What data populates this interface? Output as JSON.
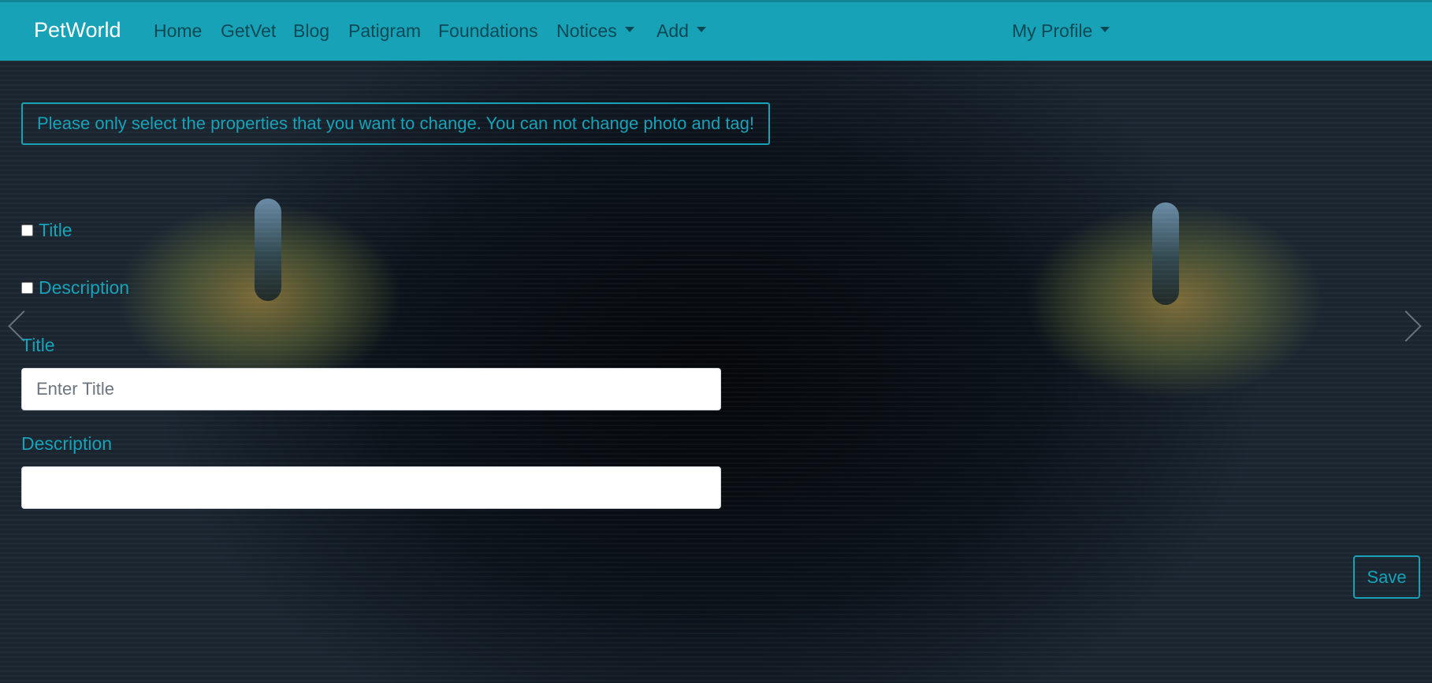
{
  "app": {
    "name": "PetWorld"
  },
  "nav": {
    "items": [
      {
        "label": "Home",
        "dropdown": false
      },
      {
        "label": "GetVet",
        "dropdown": false
      },
      {
        "label": "Blog",
        "dropdown": false
      },
      {
        "label": "Patigram",
        "dropdown": false
      },
      {
        "label": "Foundations",
        "dropdown": false
      },
      {
        "label": "Notices",
        "dropdown": true
      },
      {
        "label": "Add",
        "dropdown": true
      }
    ],
    "profile": {
      "label": "My Profile",
      "dropdown": true
    }
  },
  "form": {
    "notice": "Please only select the properties that you want to change. You can not change photo and tag!",
    "checkboxes": [
      {
        "label": "Title",
        "checked": false
      },
      {
        "label": "Description",
        "checked": false
      }
    ],
    "title": {
      "label": "Title",
      "value": "",
      "placeholder": "Enter Title"
    },
    "description": {
      "label": "Description",
      "value": "",
      "placeholder": ""
    },
    "save_label": "Save"
  },
  "colors": {
    "primary": "#17a2b8",
    "nav_text": "#4a4a4a",
    "background": "#0f1820"
  },
  "icons": {
    "carousel_prev": "chevron-left-icon",
    "carousel_next": "chevron-right-icon",
    "dropdown": "caret-down-icon"
  }
}
